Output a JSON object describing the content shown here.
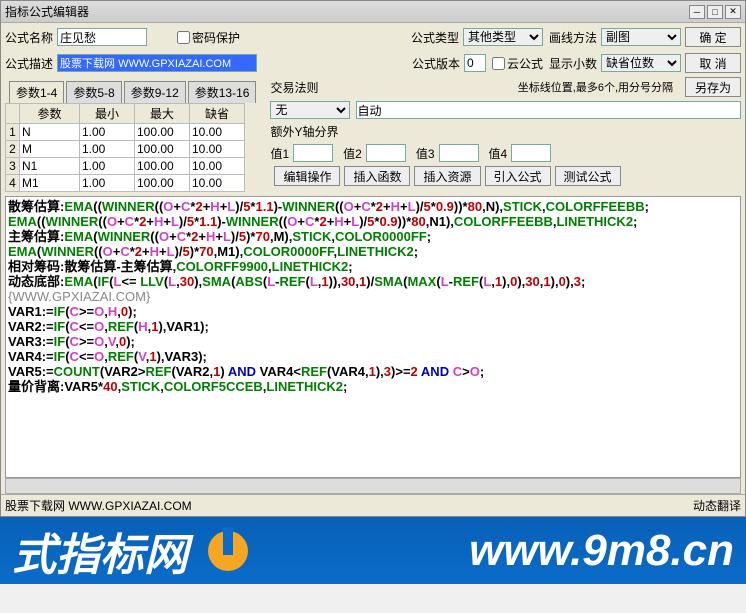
{
  "window": {
    "title": "指标公式编辑器"
  },
  "labels": {
    "formula_name": "公式名称",
    "password_protect": "密码保护",
    "formula_type": "公式类型",
    "draw_method": "画线方法",
    "formula_desc": "公式描述",
    "formula_version": "公式版本",
    "cloud_formula": "云公式",
    "decimals": "显示小数",
    "trade_rule": "交易法则",
    "coord_hint": "坐标线位置,最多6个,用分号分隔",
    "extra_axis": "额外Y轴分界",
    "val1": "值1",
    "val2": "值2",
    "val3": "值3",
    "val4": "值4",
    "auto_translate": "动态翻译"
  },
  "values": {
    "formula_name": "庄见愁",
    "formula_desc": "股票下载网 WWW.GPXIAZAI.COM",
    "formula_type": "其他类型",
    "draw_method": "副图",
    "version": "0",
    "decimals": "缺省位数",
    "trade_rule": "无",
    "coord_auto": "自动"
  },
  "buttons": {
    "ok": "确  定",
    "cancel": "取  消",
    "save_as": "另存为",
    "edit_op": "编辑操作",
    "insert_func": "插入函数",
    "insert_res": "插入资源",
    "import_formula": "引入公式",
    "test_formula": "测试公式"
  },
  "tabs": [
    "参数1-4",
    "参数5-8",
    "参数9-12",
    "参数13-16"
  ],
  "param_headers": [
    "参数",
    "最小",
    "最大",
    "缺省"
  ],
  "params": [
    {
      "n": "1",
      "name": "N",
      "min": "1.00",
      "max": "100.00",
      "def": "10.00"
    },
    {
      "n": "2",
      "name": "M",
      "min": "1.00",
      "max": "100.00",
      "def": "10.00"
    },
    {
      "n": "3",
      "name": "N1",
      "min": "1.00",
      "max": "100.00",
      "def": "10.00"
    },
    {
      "n": "4",
      "name": "M1",
      "min": "1.00",
      "max": "100.00",
      "def": "10.00"
    }
  ],
  "statusbar": {
    "left": "股票下载网 WWW.GPXIAZAI.COM"
  },
  "footer": {
    "left_text": "式指标网",
    "right_text": "www.9m8.cn"
  },
  "editor": [
    [
      [
        "散筹估算:",
        "black"
      ],
      [
        "EMA",
        "green"
      ],
      [
        "((",
        "black"
      ],
      [
        "WINNER",
        "green"
      ],
      [
        "((",
        "black"
      ],
      [
        "O",
        "pink"
      ],
      [
        "+",
        "black"
      ],
      [
        "C",
        "pink"
      ],
      [
        "*",
        "black"
      ],
      [
        "2",
        "red"
      ],
      [
        "+",
        "black"
      ],
      [
        "H",
        "pink"
      ],
      [
        "+",
        "black"
      ],
      [
        "L",
        "pink"
      ],
      [
        ")/",
        "black"
      ],
      [
        "5",
        "red"
      ],
      [
        "*",
        "black"
      ],
      [
        "1.1",
        "red"
      ],
      [
        ")-",
        "black"
      ],
      [
        "WINNER",
        "green"
      ],
      [
        "((",
        "black"
      ],
      [
        "O",
        "pink"
      ],
      [
        "+",
        "black"
      ],
      [
        "C",
        "pink"
      ],
      [
        "*",
        "black"
      ],
      [
        "2",
        "red"
      ],
      [
        "+",
        "black"
      ],
      [
        "H",
        "pink"
      ],
      [
        "+",
        "black"
      ],
      [
        "L",
        "pink"
      ],
      [
        ")/",
        "black"
      ],
      [
        "5",
        "red"
      ],
      [
        "*",
        "black"
      ],
      [
        "0.9",
        "red"
      ],
      [
        "))*",
        "black"
      ],
      [
        "80",
        "red"
      ],
      [
        ",N),",
        "black"
      ],
      [
        "STICK",
        "green"
      ],
      [
        ",",
        "black"
      ],
      [
        "COLORFFEEBB",
        "green"
      ],
      [
        ";",
        "black"
      ]
    ],
    [
      [
        "EMA",
        "green"
      ],
      [
        "((",
        "black"
      ],
      [
        "WINNER",
        "green"
      ],
      [
        "((",
        "black"
      ],
      [
        "O",
        "pink"
      ],
      [
        "+",
        "black"
      ],
      [
        "C",
        "pink"
      ],
      [
        "*",
        "black"
      ],
      [
        "2",
        "red"
      ],
      [
        "+",
        "black"
      ],
      [
        "H",
        "pink"
      ],
      [
        "+",
        "black"
      ],
      [
        "L",
        "pink"
      ],
      [
        ")/",
        "black"
      ],
      [
        "5",
        "red"
      ],
      [
        "*",
        "black"
      ],
      [
        "1.1",
        "red"
      ],
      [
        ")-",
        "black"
      ],
      [
        "WINNER",
        "green"
      ],
      [
        "((",
        "black"
      ],
      [
        "O",
        "pink"
      ],
      [
        "+",
        "black"
      ],
      [
        "C",
        "pink"
      ],
      [
        "*",
        "black"
      ],
      [
        "2",
        "red"
      ],
      [
        "+",
        "black"
      ],
      [
        "H",
        "pink"
      ],
      [
        "+",
        "black"
      ],
      [
        "L",
        "pink"
      ],
      [
        ")/",
        "black"
      ],
      [
        "5",
        "red"
      ],
      [
        "*",
        "black"
      ],
      [
        "0.9",
        "red"
      ],
      [
        "))*",
        "black"
      ],
      [
        "80",
        "red"
      ],
      [
        ",N1),",
        "black"
      ],
      [
        "COLORFFEEBB",
        "green"
      ],
      [
        ",",
        "black"
      ],
      [
        "LINETHICK2",
        "green"
      ],
      [
        ";",
        "black"
      ]
    ],
    [
      [
        "主筹估算:",
        "black"
      ],
      [
        "EMA",
        "green"
      ],
      [
        "(",
        "black"
      ],
      [
        "WINNER",
        "green"
      ],
      [
        "((",
        "black"
      ],
      [
        "O",
        "pink"
      ],
      [
        "+",
        "black"
      ],
      [
        "C",
        "pink"
      ],
      [
        "*",
        "black"
      ],
      [
        "2",
        "red"
      ],
      [
        "+",
        "black"
      ],
      [
        "H",
        "pink"
      ],
      [
        "+",
        "black"
      ],
      [
        "L",
        "pink"
      ],
      [
        ")/",
        "black"
      ],
      [
        "5",
        "red"
      ],
      [
        ")*",
        "black"
      ],
      [
        "70",
        "red"
      ],
      [
        ",M),",
        "black"
      ],
      [
        "STICK",
        "green"
      ],
      [
        ",",
        "black"
      ],
      [
        "COLOR0000FF",
        "green"
      ],
      [
        ";",
        "black"
      ]
    ],
    [
      [
        "EMA",
        "green"
      ],
      [
        "(",
        "black"
      ],
      [
        "WINNER",
        "green"
      ],
      [
        "((",
        "black"
      ],
      [
        "O",
        "pink"
      ],
      [
        "+",
        "black"
      ],
      [
        "C",
        "pink"
      ],
      [
        "*",
        "black"
      ],
      [
        "2",
        "red"
      ],
      [
        "+",
        "black"
      ],
      [
        "H",
        "pink"
      ],
      [
        "+",
        "black"
      ],
      [
        "L",
        "pink"
      ],
      [
        ")/",
        "black"
      ],
      [
        "5",
        "red"
      ],
      [
        ")*",
        "black"
      ],
      [
        "70",
        "red"
      ],
      [
        ",M1),",
        "black"
      ],
      [
        "COLOR0000FF",
        "green"
      ],
      [
        ",",
        "black"
      ],
      [
        "LINETHICK2",
        "green"
      ],
      [
        ";",
        "black"
      ]
    ],
    [
      [
        "相对筹码:散筹估算-主筹估算,",
        "black"
      ],
      [
        "COLORFF9900",
        "green"
      ],
      [
        ",",
        "black"
      ],
      [
        "LINETHICK2",
        "green"
      ],
      [
        ";",
        "black"
      ]
    ],
    [
      [
        "动态底部:",
        "black"
      ],
      [
        "EMA",
        "green"
      ],
      [
        "(",
        "black"
      ],
      [
        "IF",
        "green"
      ],
      [
        "(",
        "black"
      ],
      [
        "L",
        "pink"
      ],
      [
        "<= ",
        "black"
      ],
      [
        "LLV",
        "green"
      ],
      [
        "(",
        "black"
      ],
      [
        "L",
        "pink"
      ],
      [
        ",",
        "black"
      ],
      [
        "30",
        "red"
      ],
      [
        "),",
        "black"
      ],
      [
        "SMA",
        "green"
      ],
      [
        "(",
        "black"
      ],
      [
        "ABS",
        "green"
      ],
      [
        "(",
        "black"
      ],
      [
        "L",
        "pink"
      ],
      [
        "-",
        "black"
      ],
      [
        "REF",
        "green"
      ],
      [
        "(",
        "black"
      ],
      [
        "L",
        "pink"
      ],
      [
        ",",
        "black"
      ],
      [
        "1",
        "red"
      ],
      [
        ")),",
        "black"
      ],
      [
        "30",
        "red"
      ],
      [
        ",",
        "black"
      ],
      [
        "1",
        "red"
      ],
      [
        ")/",
        "black"
      ],
      [
        "SMA",
        "green"
      ],
      [
        "(",
        "black"
      ],
      [
        "MAX",
        "green"
      ],
      [
        "(",
        "black"
      ],
      [
        "L",
        "pink"
      ],
      [
        "-",
        "black"
      ],
      [
        "REF",
        "green"
      ],
      [
        "(",
        "black"
      ],
      [
        "L",
        "pink"
      ],
      [
        ",",
        "black"
      ],
      [
        "1",
        "red"
      ],
      [
        "),",
        "black"
      ],
      [
        "0",
        "red"
      ],
      [
        "),",
        "black"
      ],
      [
        "30",
        "red"
      ],
      [
        ",",
        "black"
      ],
      [
        "1",
        "red"
      ],
      [
        "),",
        "black"
      ],
      [
        "0",
        "red"
      ],
      [
        "),",
        "black"
      ],
      [
        "3",
        "red"
      ],
      [
        ";",
        "black"
      ]
    ],
    [
      [
        "{WWW.GPXIAZAI.COM}",
        "gray"
      ]
    ],
    [
      [
        "VAR1:=",
        "black"
      ],
      [
        "IF",
        "green"
      ],
      [
        "(",
        "black"
      ],
      [
        "C",
        "pink"
      ],
      [
        ">=",
        "black"
      ],
      [
        "O",
        "pink"
      ],
      [
        ",",
        "black"
      ],
      [
        "H",
        "pink"
      ],
      [
        ",",
        "black"
      ],
      [
        "0",
        "red"
      ],
      [
        ");",
        "black"
      ]
    ],
    [
      [
        "VAR2:=",
        "black"
      ],
      [
        "IF",
        "green"
      ],
      [
        "(",
        "black"
      ],
      [
        "C",
        "pink"
      ],
      [
        "<=",
        "black"
      ],
      [
        "O",
        "pink"
      ],
      [
        ",",
        "black"
      ],
      [
        "REF",
        "green"
      ],
      [
        "(",
        "black"
      ],
      [
        "H",
        "pink"
      ],
      [
        ",",
        "black"
      ],
      [
        "1",
        "red"
      ],
      [
        "),VAR1);",
        "black"
      ]
    ],
    [
      [
        "VAR3:=",
        "black"
      ],
      [
        "IF",
        "green"
      ],
      [
        "(",
        "black"
      ],
      [
        "C",
        "pink"
      ],
      [
        ">=",
        "black"
      ],
      [
        "O",
        "pink"
      ],
      [
        ",",
        "black"
      ],
      [
        "V",
        "pink"
      ],
      [
        ",",
        "black"
      ],
      [
        "0",
        "red"
      ],
      [
        ");",
        "black"
      ]
    ],
    [
      [
        "VAR4:=",
        "black"
      ],
      [
        "IF",
        "green"
      ],
      [
        "(",
        "black"
      ],
      [
        "C",
        "pink"
      ],
      [
        "<=",
        "black"
      ],
      [
        "O",
        "pink"
      ],
      [
        ",",
        "black"
      ],
      [
        "REF",
        "green"
      ],
      [
        "(",
        "black"
      ],
      [
        "V",
        "pink"
      ],
      [
        ",",
        "black"
      ],
      [
        "1",
        "red"
      ],
      [
        "),VAR3);",
        "black"
      ]
    ],
    [
      [
        "VAR5:=",
        "black"
      ],
      [
        "COUNT",
        "green"
      ],
      [
        "(VAR2>",
        "black"
      ],
      [
        "REF",
        "green"
      ],
      [
        "(VAR2,",
        "black"
      ],
      [
        "1",
        "red"
      ],
      [
        ") ",
        "black"
      ],
      [
        "AND",
        "blue"
      ],
      [
        " VAR4<",
        "black"
      ],
      [
        "REF",
        "green"
      ],
      [
        "(VAR4,",
        "black"
      ],
      [
        "1",
        "red"
      ],
      [
        "),",
        "black"
      ],
      [
        "3",
        "red"
      ],
      [
        ")>=",
        "black"
      ],
      [
        "2",
        "red"
      ],
      [
        " ",
        "black"
      ],
      [
        "AND",
        "blue"
      ],
      [
        " ",
        "black"
      ],
      [
        "C",
        "pink"
      ],
      [
        ">",
        "black"
      ],
      [
        "O",
        "pink"
      ],
      [
        ";",
        "black"
      ]
    ],
    [
      [
        "量价背离:VAR5*",
        "black"
      ],
      [
        "40",
        "red"
      ],
      [
        ",",
        "black"
      ],
      [
        "STICK",
        "green"
      ],
      [
        ",",
        "black"
      ],
      [
        "COLORF5CCEB",
        "green"
      ],
      [
        ",",
        "black"
      ],
      [
        "LINETHICK2",
        "green"
      ],
      [
        ";",
        "black"
      ]
    ]
  ]
}
